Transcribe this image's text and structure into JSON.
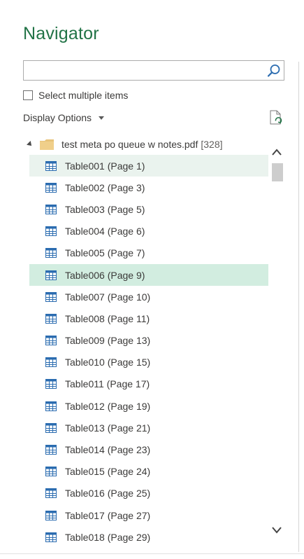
{
  "header": {
    "title": "Navigator"
  },
  "search": {
    "value": "",
    "placeholder": ""
  },
  "select_multiple": {
    "label": "Select multiple items",
    "checked": false
  },
  "display_options": {
    "label": "Display Options"
  },
  "tree": {
    "root": {
      "label": "test meta po queue w notes.pdf",
      "count": "[328]",
      "expanded": true
    },
    "items": [
      {
        "label": "Table001 (Page 1)",
        "state": "selected"
      },
      {
        "label": "Table002 (Page 3)",
        "state": ""
      },
      {
        "label": "Table003 (Page 5)",
        "state": ""
      },
      {
        "label": "Table004 (Page 6)",
        "state": ""
      },
      {
        "label": "Table005 (Page 7)",
        "state": ""
      },
      {
        "label": "Table006 (Page 9)",
        "state": "highlight"
      },
      {
        "label": "Table007 (Page 10)",
        "state": ""
      },
      {
        "label": "Table008 (Page 11)",
        "state": ""
      },
      {
        "label": "Table009 (Page 13)",
        "state": ""
      },
      {
        "label": "Table010 (Page 15)",
        "state": ""
      },
      {
        "label": "Table011 (Page 17)",
        "state": ""
      },
      {
        "label": "Table012 (Page 19)",
        "state": ""
      },
      {
        "label": "Table013 (Page 21)",
        "state": ""
      },
      {
        "label": "Table014 (Page 23)",
        "state": ""
      },
      {
        "label": "Table015 (Page 24)",
        "state": ""
      },
      {
        "label": "Table016 (Page 25)",
        "state": ""
      },
      {
        "label": "Table017 (Page 27)",
        "state": ""
      },
      {
        "label": "Table018 (Page 29)",
        "state": ""
      }
    ]
  },
  "icons": {
    "search": "search-icon",
    "refresh": "refresh-document-icon",
    "folder": "folder-icon",
    "table": "table-icon"
  },
  "colors": {
    "title": "#217346",
    "selected_row": "#eaf3ee",
    "highlight_row": "#d2ede0",
    "folder": "#e8c37a",
    "table_icon": "#2b6cb0"
  }
}
